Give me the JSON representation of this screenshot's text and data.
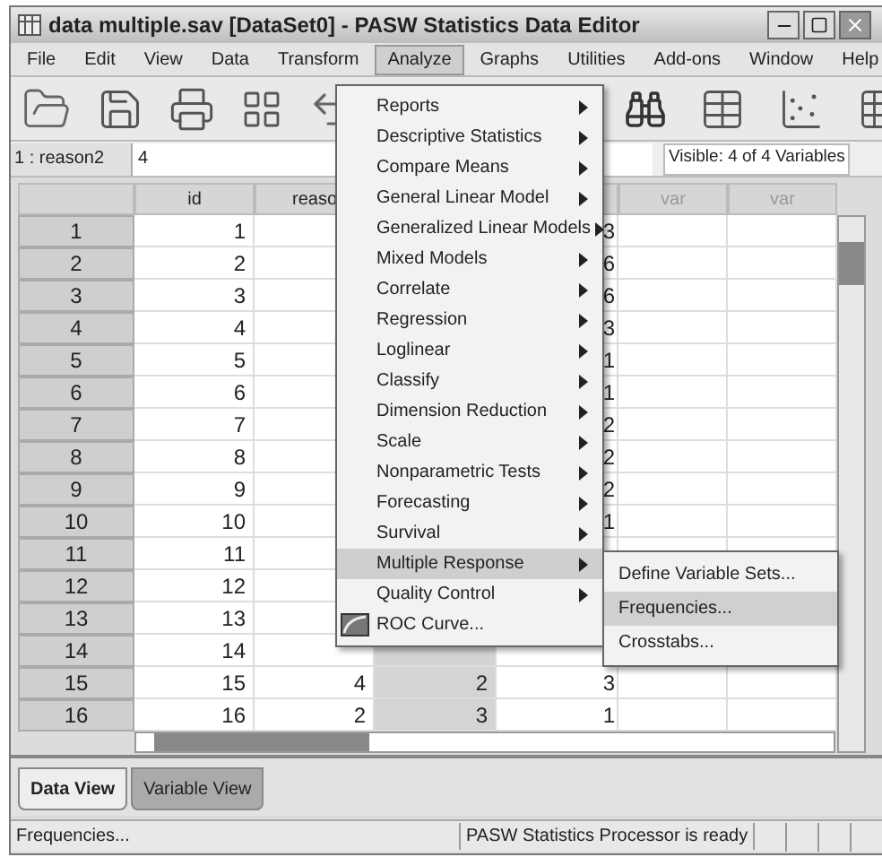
{
  "window": {
    "title": "data multiple.sav [DataSet0] - PASW Statistics Data Editor"
  },
  "menu_bar": [
    {
      "label": "File",
      "selected": false
    },
    {
      "label": "Edit",
      "selected": false
    },
    {
      "label": "View",
      "selected": false
    },
    {
      "label": "Data",
      "selected": false
    },
    {
      "label": "Transform",
      "selected": false
    },
    {
      "label": "Analyze",
      "selected": true
    },
    {
      "label": "Graphs",
      "selected": false
    },
    {
      "label": "Utilities",
      "selected": false
    },
    {
      "label": "Add-ons",
      "selected": false
    },
    {
      "label": "Window",
      "selected": false
    },
    {
      "label": "Help",
      "selected": false
    }
  ],
  "cell_editor": {
    "cell": "1 : reason2",
    "value": "4",
    "visible": "Visible: 4 of 4 Variables"
  },
  "table": {
    "columns": [
      {
        "label": "id",
        "selected": false
      },
      {
        "label": "reaso",
        "selected": false
      },
      {
        "selected": true
      },
      {
        "selected": false
      },
      {
        "label": "var",
        "selected": false
      },
      {
        "label": "var",
        "selected": false
      }
    ],
    "rows": [
      {
        "header": "1",
        "id": "1",
        "column_4": "3"
      },
      {
        "header": "2",
        "id": "2",
        "column_4": "6"
      },
      {
        "header": "3",
        "id": "3",
        "column_4": "6"
      },
      {
        "header": "4",
        "id": "4",
        "column_4": "3"
      },
      {
        "header": "5",
        "id": "5",
        "column_4": "1"
      },
      {
        "header": "6",
        "id": "6",
        "column_4": "1"
      },
      {
        "header": "7",
        "id": "7",
        "column_4": "2"
      },
      {
        "header": "8",
        "id": "8",
        "column_4": "2"
      },
      {
        "header": "9",
        "id": "9",
        "column_4": "2"
      },
      {
        "header": "10",
        "id": "10",
        "column_4": "1"
      },
      {
        "header": "11",
        "id": "11"
      },
      {
        "header": "12",
        "id": "12"
      },
      {
        "header": "13",
        "id": "13"
      },
      {
        "header": "14",
        "id": "14"
      },
      {
        "header": "15",
        "id": "15",
        "column_2": "4",
        "column_3": "2",
        "column_4": "3"
      },
      {
        "header": "16",
        "id": "16",
        "column_2": "2",
        "column_3": "3",
        "column_4": "1"
      }
    ]
  },
  "analyze_menu": [
    {
      "label": "Reports",
      "kind": "submenu",
      "selected": false
    },
    {
      "label": "Descriptive Statistics",
      "kind": "submenu",
      "selected": false
    },
    {
      "label": "Compare Means",
      "kind": "submenu",
      "selected": false
    },
    {
      "label": "General Linear Model",
      "kind": "submenu",
      "selected": false
    },
    {
      "label": "Generalized Linear Models",
      "kind": "submenu",
      "selected": false
    },
    {
      "label": "Mixed Models",
      "kind": "submenu",
      "selected": false
    },
    {
      "label": "Correlate",
      "kind": "submenu",
      "selected": false
    },
    {
      "label": "Regression",
      "kind": "submenu",
      "selected": false
    },
    {
      "label": "Loglinear",
      "kind": "submenu",
      "selected": false
    },
    {
      "label": "Classify",
      "kind": "submenu",
      "selected": false
    },
    {
      "label": "Dimension Reduction",
      "kind": "submenu",
      "selected": false
    },
    {
      "label": "Scale",
      "kind": "submenu",
      "selected": false
    },
    {
      "label": "Nonparametric Tests",
      "kind": "submenu",
      "selected": false
    },
    {
      "label": "Forecasting",
      "kind": "submenu",
      "selected": false
    },
    {
      "label": "Survival",
      "kind": "submenu",
      "selected": false
    },
    {
      "label": "Multiple Response",
      "kind": "submenu",
      "selected": true
    },
    {
      "label": "Quality Control",
      "kind": "submenu",
      "selected": false
    },
    {
      "label": "ROC Curve...",
      "kind": "command",
      "selected": false
    }
  ],
  "submenu": [
    {
      "label": "Define Variable Sets...",
      "selected": false
    },
    {
      "label": "Frequencies...",
      "selected": true
    },
    {
      "label": "Crosstabs...",
      "selected": false
    }
  ],
  "view_tabs": [
    {
      "label": "Data View",
      "selected": true
    },
    {
      "label": "Variable View",
      "selected": false
    }
  ],
  "status_bar": {
    "message": "Frequencies...",
    "processor": "PASW Statistics Processor is ready"
  }
}
